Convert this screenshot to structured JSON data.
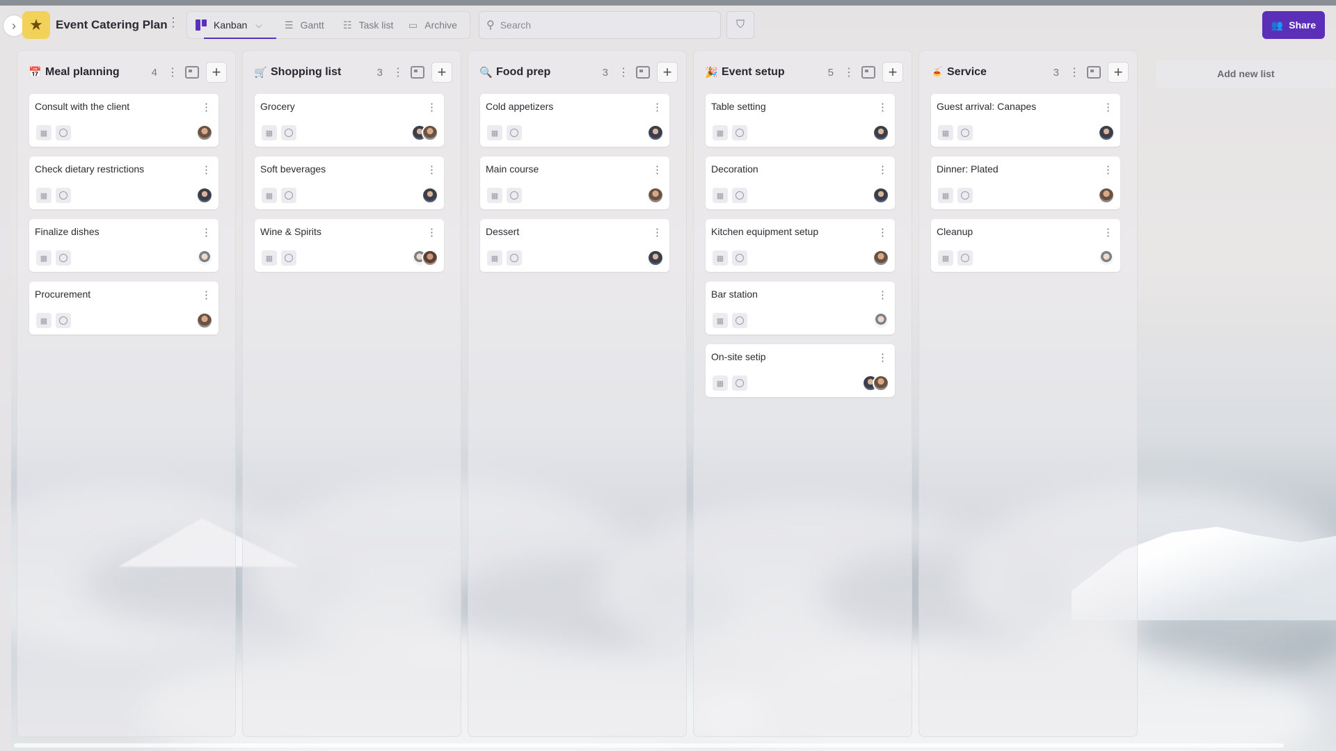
{
  "project": {
    "title": "Event Catering Plan"
  },
  "views": [
    {
      "label": "Kanban",
      "icon": "kanban-icon",
      "active": true
    },
    {
      "label": "Gantt",
      "icon": "gantt-icon"
    },
    {
      "label": "Task list",
      "icon": "list-icon"
    },
    {
      "label": "Archive",
      "icon": "archive-icon"
    }
  ],
  "search": {
    "placeholder": "Search"
  },
  "share": {
    "label": "Share"
  },
  "add_list": {
    "label": "Add new list"
  },
  "colors": {
    "accent": "#5b2fb8",
    "star": "#f3d25a"
  },
  "columns": [
    {
      "title": "Meal planning",
      "emoji": "📅",
      "count": "4",
      "cards": [
        {
          "title": "Consult with the client",
          "avatars": [
            "a1"
          ]
        },
        {
          "title": "Check dietary restrictions",
          "avatars": [
            "a2"
          ]
        },
        {
          "title": "Finalize dishes",
          "avatars": [
            "a3"
          ]
        },
        {
          "title": "Procurement",
          "avatars": [
            "a1"
          ]
        }
      ]
    },
    {
      "title": "Shopping list",
      "emoji": "🛒",
      "count": "3",
      "cards": [
        {
          "title": "Grocery",
          "avatars": [
            "a1",
            "a2"
          ]
        },
        {
          "title": "Soft beverages",
          "avatars": [
            "a2"
          ]
        },
        {
          "title": "Wine & Spirits",
          "avatars": [
            "a4",
            "a3"
          ]
        }
      ]
    },
    {
      "title": "Food prep",
      "emoji": "🔍",
      "count": "3",
      "cards": [
        {
          "title": "Cold appetizers",
          "avatars": [
            "a2"
          ]
        },
        {
          "title": "Main course",
          "avatars": [
            "a1"
          ]
        },
        {
          "title": "Dessert",
          "avatars": [
            "a2"
          ]
        }
      ]
    },
    {
      "title": "Event setup",
      "emoji": "🎉",
      "count": "5",
      "cards": [
        {
          "title": "Table setting",
          "avatars": [
            "a2"
          ]
        },
        {
          "title": "Decoration",
          "avatars": [
            "a2"
          ]
        },
        {
          "title": "Kitchen equipment setup",
          "avatars": [
            "a1"
          ]
        },
        {
          "title": "Bar station",
          "avatars": [
            "a3"
          ]
        },
        {
          "title": "On-site setip",
          "avatars": [
            "a1",
            "a2"
          ]
        }
      ]
    },
    {
      "title": "Service",
      "emoji": "🍝",
      "count": "3",
      "cards": [
        {
          "title": "Guest arrival: Canapes",
          "avatars": [
            "a2"
          ]
        },
        {
          "title": "Dinner: Plated",
          "avatars": [
            "a1"
          ]
        },
        {
          "title": "Cleanup",
          "avatars": [
            "a3"
          ]
        }
      ]
    }
  ]
}
